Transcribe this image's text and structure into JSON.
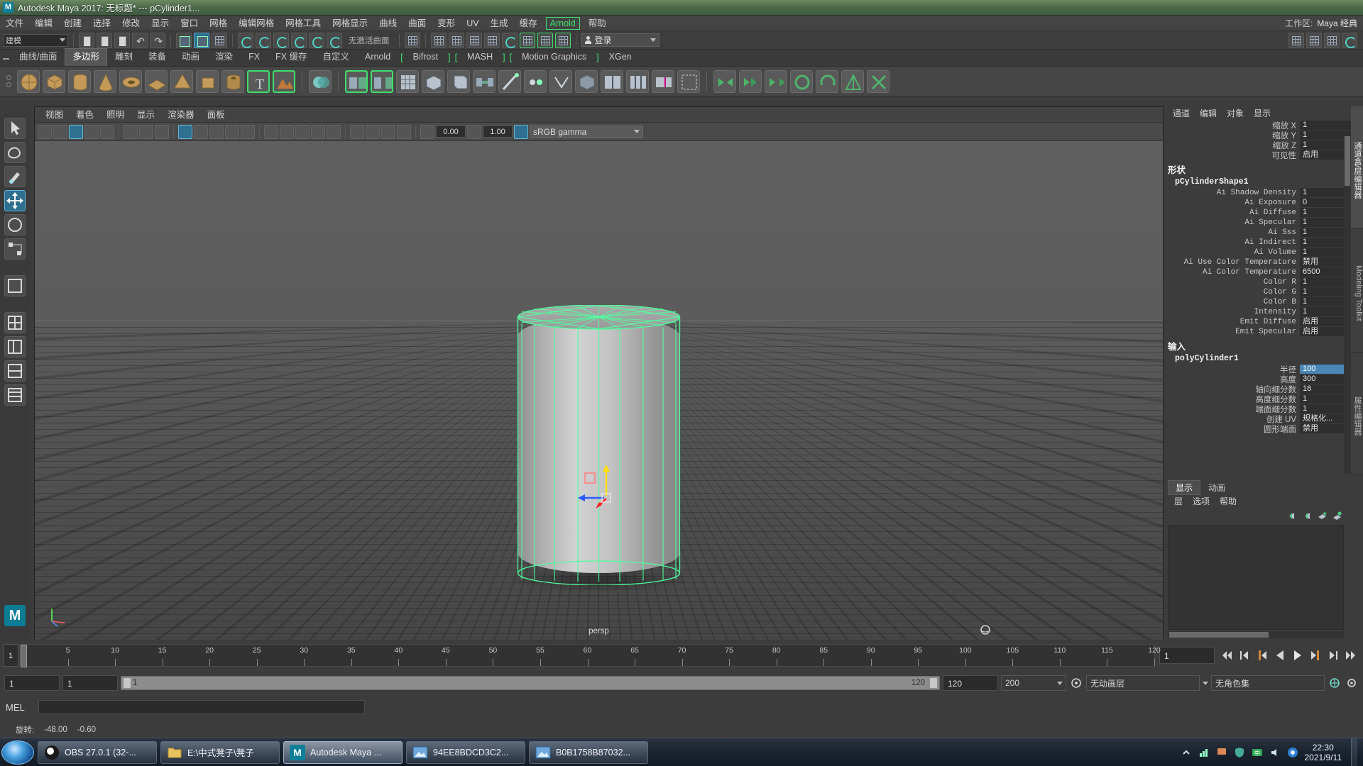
{
  "window": {
    "app_icon": "maya-logo-icon",
    "title": "Autodesk Maya 2017: 无标题*   ---   pCylinder1..."
  },
  "menubar": {
    "items": [
      "文件",
      "编辑",
      "创建",
      "选择",
      "修改",
      "显示",
      "窗口",
      "网格",
      "编辑网格",
      "网格工具",
      "网格显示",
      "曲线",
      "曲面",
      "变形",
      "UV",
      "生成",
      "缓存"
    ],
    "arnold": "Arnold",
    "help": "帮助",
    "workspace_label": "工作区:",
    "workspace_value": "Maya 经典"
  },
  "statusline": {
    "mode": "建模",
    "no_live_surface": "无激活曲面",
    "login": "登录"
  },
  "shelf": {
    "tabs": [
      "曲线/曲面",
      "多边形",
      "雕刻",
      "装备",
      "动画",
      "渲染",
      "FX",
      "FX 缓存",
      "自定义",
      "Arnold",
      "Bifrost",
      "MASH",
      "Motion Graphics",
      "XGen"
    ],
    "active_tab": "多边形",
    "bracket_tabs": [
      "Bifrost",
      "MASH",
      "Motion Graphics"
    ]
  },
  "viewport": {
    "menus": [
      "视图",
      "着色",
      "照明",
      "显示",
      "渲染器",
      "面板"
    ],
    "exposure": "0.00",
    "gamma": "1.00",
    "color_profile": "sRGB gamma",
    "camera_label": "persp",
    "axis_labels": [
      "y",
      "x",
      "z"
    ]
  },
  "channelbox": {
    "menus": [
      "通道",
      "编辑",
      "对象",
      "显示"
    ],
    "transform_rows": [
      {
        "label": "缩放 X",
        "value": "1"
      },
      {
        "label": "缩放 Y",
        "value": "1"
      },
      {
        "label": "缩放 Z",
        "value": "1"
      },
      {
        "label": "可见性",
        "value": "启用"
      }
    ],
    "shape_header": "形状",
    "shape_node": "pCylinderShape1",
    "shape_rows": [
      {
        "label": "Ai Shadow Density",
        "value": "1"
      },
      {
        "label": "Ai Exposure",
        "value": "0"
      },
      {
        "label": "Ai Diffuse",
        "value": "1"
      },
      {
        "label": "Ai Specular",
        "value": "1"
      },
      {
        "label": "Ai Sss",
        "value": "1"
      },
      {
        "label": "Ai Indirect",
        "value": "1"
      },
      {
        "label": "Ai Volume",
        "value": "1"
      },
      {
        "label": "Ai Use Color Temperature",
        "value": "禁用"
      },
      {
        "label": "Ai Color Temperature",
        "value": "6500"
      },
      {
        "label": "Color R",
        "value": "1"
      },
      {
        "label": "Color G",
        "value": "1"
      },
      {
        "label": "Color B",
        "value": "1"
      },
      {
        "label": "Intensity",
        "value": "1"
      },
      {
        "label": "Emit Diffuse",
        "value": "启用"
      },
      {
        "label": "Emit Specular",
        "value": "启用"
      }
    ],
    "inputs_header": "输入",
    "input_node": "polyCylinder1",
    "input_rows": [
      {
        "label": "半径",
        "value": "100",
        "highlight": true
      },
      {
        "label": "高度",
        "value": "300",
        "highlight": false
      },
      {
        "label": "轴向细分数",
        "value": "16",
        "highlight": false
      },
      {
        "label": "高度细分数",
        "value": "1",
        "highlight": false
      },
      {
        "label": "端面细分数",
        "value": "1",
        "highlight": false
      },
      {
        "label": "创建 UV",
        "value": "规格化...",
        "highlight": false
      },
      {
        "label": "圆形端面",
        "value": "禁用",
        "highlight": false
      }
    ]
  },
  "right_tabs": [
    "通道盒/层编辑器",
    "Modeling Toolkit",
    "属性编辑器"
  ],
  "layer_editor": {
    "tabs": [
      "显示",
      "动画"
    ],
    "active_tab": "显示",
    "menus": [
      "层",
      "选项",
      "帮助"
    ],
    "buttons": [
      "layer-prev-icon",
      "layer-prev-all-icon",
      "layer-new-icon",
      "layer-new-selected-icon"
    ]
  },
  "timeline": {
    "start_field": "1",
    "ticks": [
      5,
      10,
      15,
      20,
      25,
      30,
      35,
      40,
      45,
      50,
      55,
      60,
      65,
      70,
      75,
      80,
      85,
      90,
      95,
      100,
      105,
      110,
      115,
      120
    ],
    "current_frame": "1",
    "playback_buttons": [
      "go-to-start-icon",
      "step-back-key-icon",
      "step-back-frame-icon",
      "play-backwards-icon",
      "play-forwards-icon",
      "step-forward-frame-icon",
      "step-forward-key-icon",
      "go-to-end-icon"
    ]
  },
  "range_slider": {
    "anim_start": "1",
    "range_start": "1",
    "bar_start": "1",
    "bar_end": "120",
    "range_end": "120",
    "anim_end": "200",
    "anim_layer": "无动画层",
    "character_set": "无角色集",
    "icons": [
      "auto-key-icon",
      "animation-prefs-icon"
    ]
  },
  "command_line": {
    "label": "MEL",
    "input_value": "",
    "placeholder": ""
  },
  "help_line": {
    "tool_label": "旋转:",
    "value_a": "-48.00",
    "value_b": "-0.60"
  },
  "taskbar": {
    "start": "start-orb-icon",
    "items": [
      {
        "label": "OBS 27.0.1 (32-...",
        "icon": "obs-icon",
        "active": false
      },
      {
        "label": "E:\\中式凳子\\凳子",
        "icon": "folder-icon",
        "active": false
      },
      {
        "label": "Autodesk Maya ...",
        "icon": "maya-icon",
        "active": true
      },
      {
        "label": "94EE8BDCD3C2...",
        "icon": "image-icon",
        "active": false
      },
      {
        "label": "B0B1758B87032...",
        "icon": "image-icon",
        "active": false
      }
    ],
    "tray_icons": [
      "show-hidden-icon",
      "network-icon",
      "flag-icon",
      "shield-icon",
      "input-method-icon",
      "volume-icon",
      "antivirus-icon"
    ],
    "clock_time": "22:30",
    "clock_date": "2021/9/11"
  },
  "colors": {
    "accent_green": "#3ee06b",
    "select_blue": "#4b86b4",
    "wire_green": "#4dff9e",
    "panel_bg": "#3c3c3c",
    "viewport_bg": "#5c5c5c"
  }
}
